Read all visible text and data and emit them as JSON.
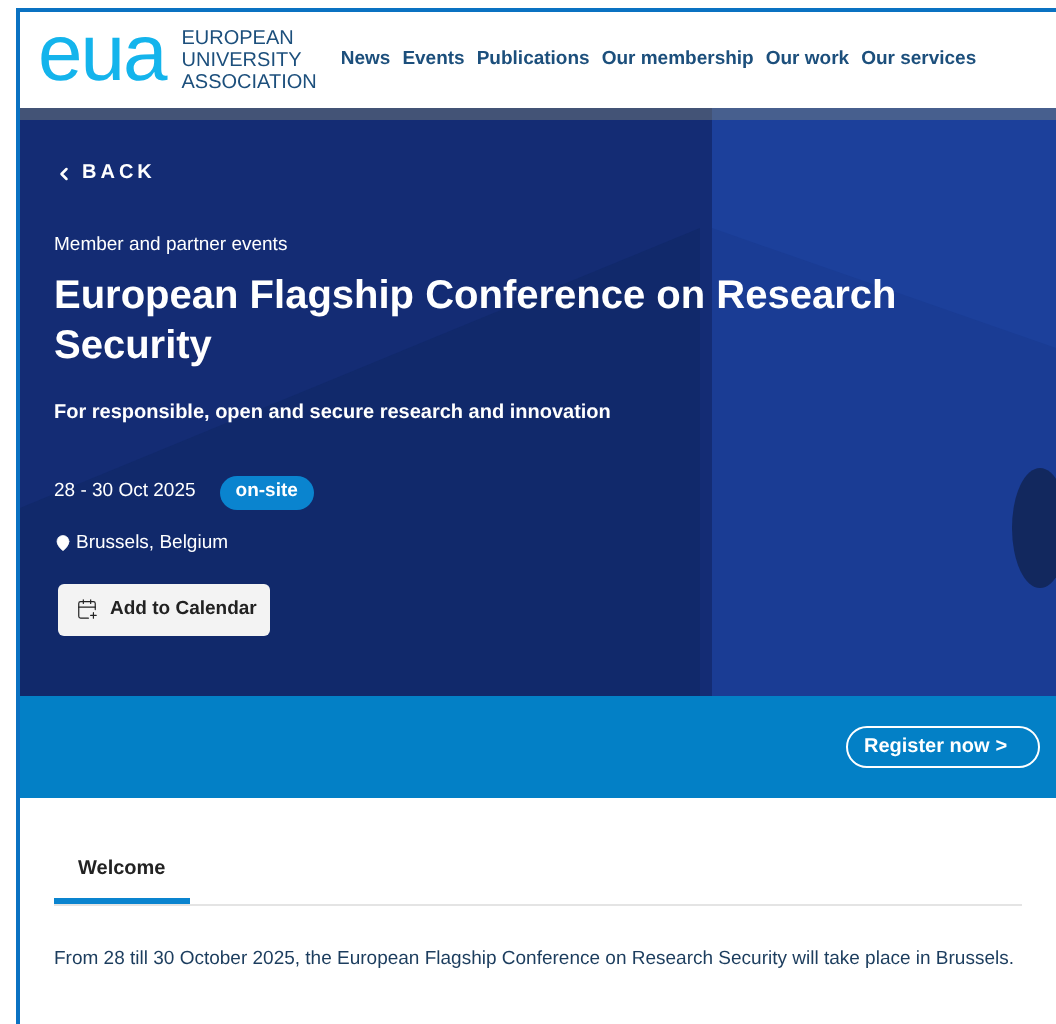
{
  "header": {
    "logo": "eua",
    "logo_lines": [
      "EUROPEAN",
      "UNIVERSITY",
      "ASSOCIATION"
    ],
    "nav": [
      "News",
      "Events",
      "Publications",
      "Our membership",
      "Our work",
      "Our services"
    ]
  },
  "hero": {
    "back": "BACK",
    "category": "Member and partner events",
    "title": "European Flagship Conference on Research Security",
    "subtitle": "For responsible, open and secure research and innovation",
    "date": "28 - 30 Oct 2025",
    "badge": "on-site",
    "location": "Brussels, Belgium",
    "calendar_button": "Add to Calendar"
  },
  "register_button": "Register now",
  "register_arrow": ">",
  "tabs": [
    {
      "label": "Welcome",
      "selected": true
    }
  ],
  "body": "From 28 till 30 October 2025, the European Flagship Conference on Research Security will take place in Brussels."
}
